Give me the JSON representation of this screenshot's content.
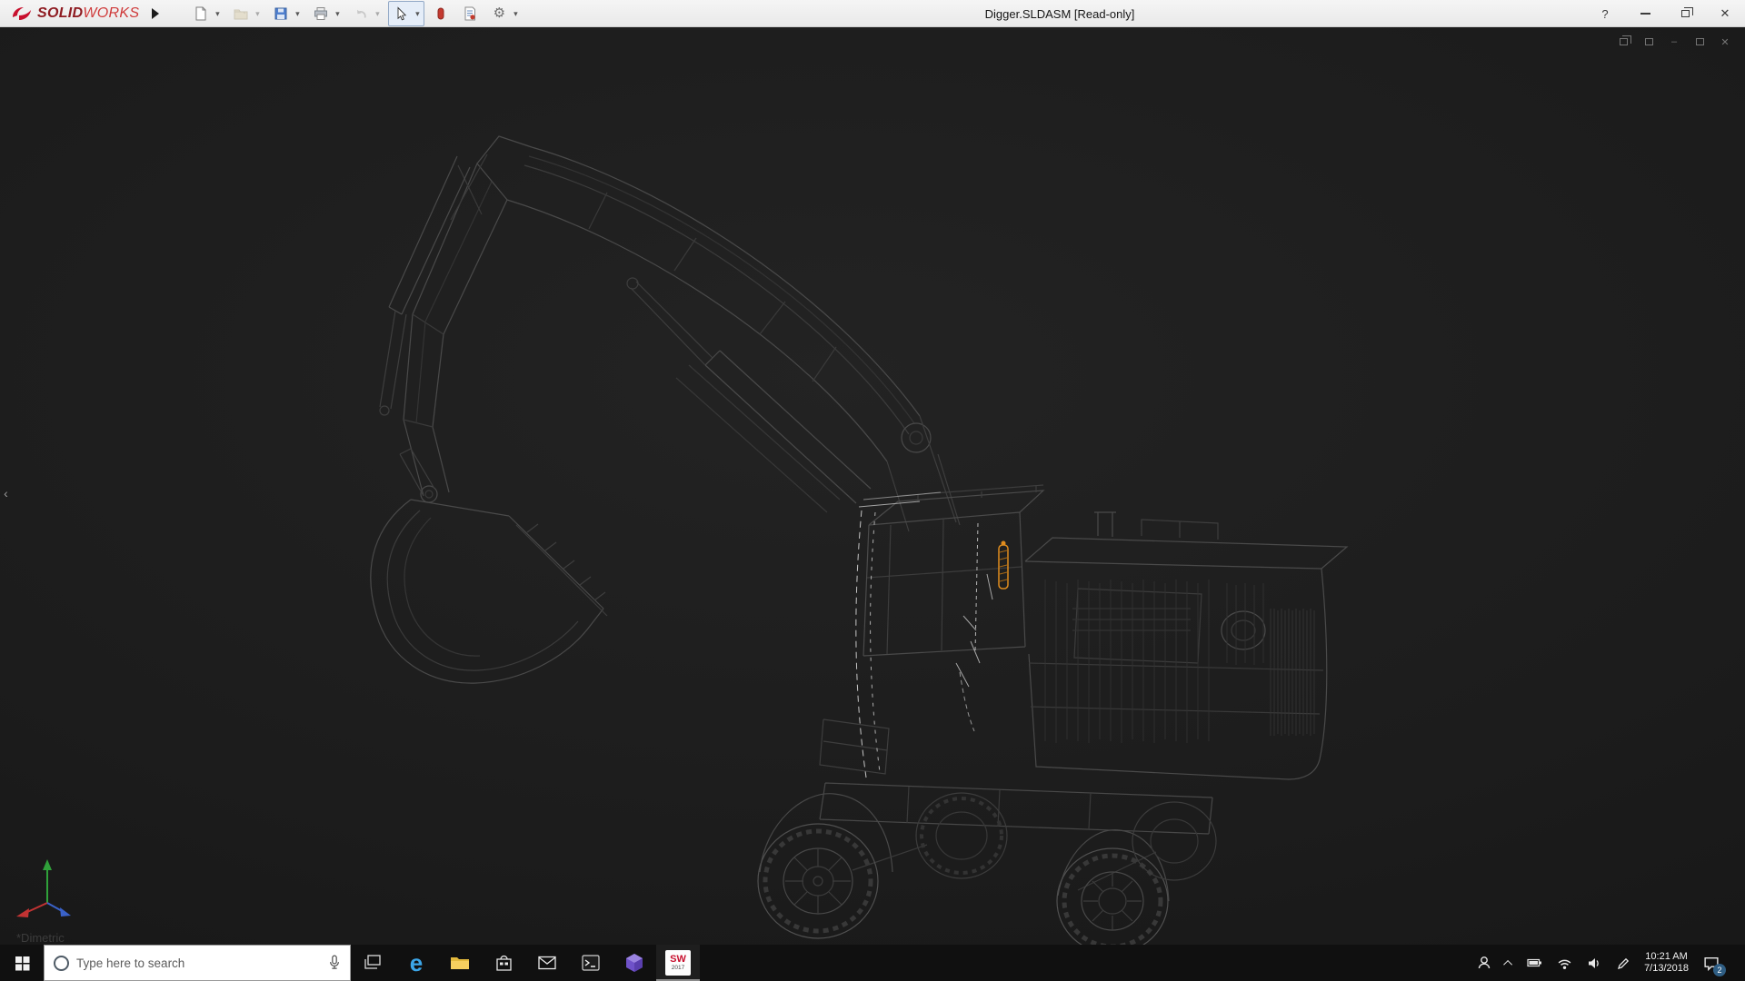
{
  "brand": {
    "solid": "SOLID",
    "works": "WORKS"
  },
  "window": {
    "title": "Digger.SLDASM [Read-only]"
  },
  "glyphs": {
    "caret": "▾",
    "gear": "⚙",
    "help": "?",
    "close": "✕",
    "minimize": "–",
    "panel_arrow": "‹",
    "edge_letter": "e"
  },
  "toolbar": {
    "items": [
      "new-document",
      "open",
      "save",
      "print",
      "undo",
      "select",
      "appearances",
      "design-report",
      "options"
    ]
  },
  "viewport": {
    "view_orientation": "*Dimetric",
    "model_name": "excavator-wireframe",
    "selected_component_color": "#df8c1e"
  },
  "taskbar": {
    "search_placeholder": "Type here to search",
    "solidworks_label": "SW",
    "solidworks_year": "2017",
    "clock_time": "10:21 AM",
    "clock_date": "7/13/2018",
    "notification_count": "2"
  }
}
